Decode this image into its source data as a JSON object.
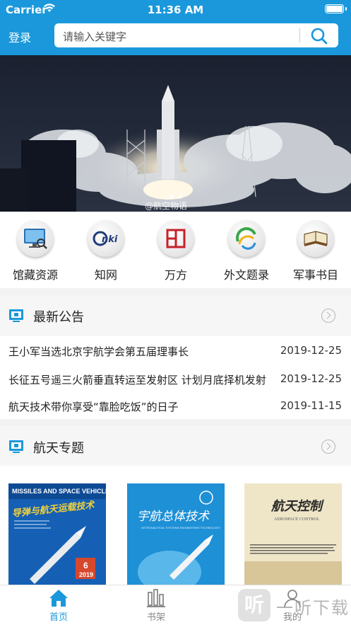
{
  "status_bar": {
    "carrier": "Carrier",
    "time": "11:36 AM"
  },
  "header": {
    "login_label": "登录",
    "search_placeholder": "请输入关键字"
  },
  "banner": {
    "caption": "@航空物语",
    "dots": 2,
    "active_dot": 0
  },
  "quick_links": [
    {
      "label": "馆藏资源",
      "icon": "monitor-search-icon"
    },
    {
      "label": "知网",
      "icon": "cnki-logo-icon"
    },
    {
      "label": "万方",
      "icon": "wanfang-logo-icon"
    },
    {
      "label": "外文题录",
      "icon": "foreign-catalog-icon"
    },
    {
      "label": "军事书目",
      "icon": "book-icon"
    }
  ],
  "notices": {
    "title": "最新公告",
    "items": [
      {
        "title": "王小军当选北京宇航学会第五届理事长",
        "date": "2019-12-25"
      },
      {
        "title": "长征五号遥三火箭垂直转运至发射区 计划月底择机发射",
        "date": "2019-12-25"
      },
      {
        "title": "航天技术带你享受“靠脸吃饭”的日子",
        "date": "2019-11-15"
      }
    ]
  },
  "topics": {
    "title": "航天专题",
    "books": [
      {
        "cover_en": "MISSILES AND SPACE VEHICLES",
        "cover_cn": "导弹与航天运载技术",
        "issue": "6",
        "year": "2019"
      },
      {
        "cover_cn": "宇航总体技术",
        "cover_en": "ASTRONAUTICAL SYSTEMS ENGINEERING TECHNOLOGY"
      },
      {
        "cover_cn": "航天控制",
        "cover_en": "AEROSPACE CONTROL"
      }
    ]
  },
  "tabbar": {
    "tabs": [
      {
        "label": "首页",
        "icon": "home-icon",
        "active": true
      },
      {
        "label": "书架",
        "icon": "bookshelf-icon",
        "active": false
      },
      {
        "label": "我的",
        "icon": "profile-icon",
        "active": false
      }
    ]
  },
  "watermark": {
    "logo": "听",
    "text": "一听下载"
  },
  "colors": {
    "brand": "#1a98db",
    "tab_active": "#1a98db",
    "tab_inactive": "#888888"
  }
}
